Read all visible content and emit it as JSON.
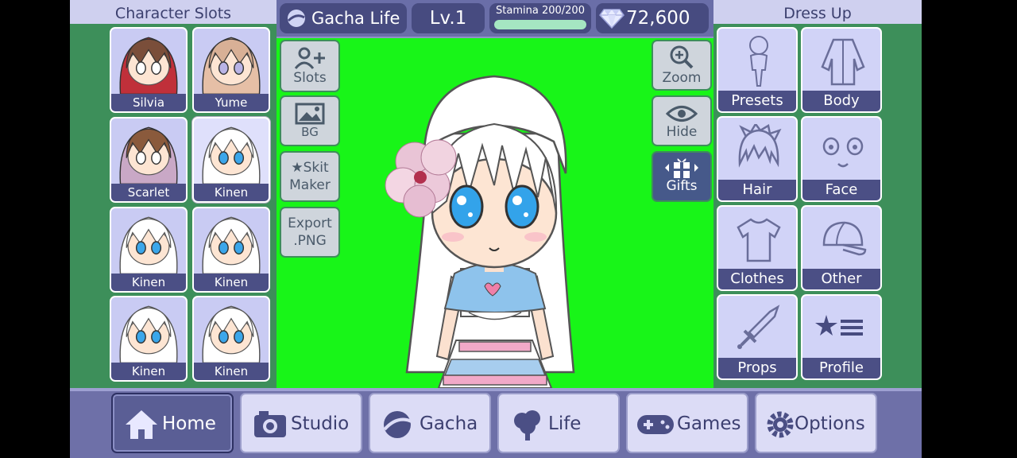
{
  "left_panel": {
    "title": "Character Slots",
    "slots": [
      {
        "name": "Silvia",
        "hair": "#c0303a",
        "hair_top": "#7a4e3a"
      },
      {
        "name": "Yume",
        "hair": "#e6bfa6",
        "hair_top": "#d8b096"
      },
      {
        "name": "Scarlet",
        "hair": "#c9a8c6",
        "hair_top": "#8a5a3c"
      },
      {
        "name": "Kinen",
        "hair": "#ffffff",
        "hair_top": "#ffffff"
      },
      {
        "name": "Kinen",
        "hair": "#ffffff",
        "hair_top": "#ffffff"
      },
      {
        "name": "Kinen",
        "hair": "#ffffff",
        "hair_top": "#ffffff"
      },
      {
        "name": "Kinen",
        "hair": "#ffffff",
        "hair_top": "#ffffff"
      },
      {
        "name": "Kinen",
        "hair": "#ffffff",
        "hair_top": "#ffffff"
      }
    ]
  },
  "topbar": {
    "game_title": "Gacha Life",
    "level": "Lv.1",
    "stamina_label": "Stamina 200/200",
    "stamina_fraction": 1.0,
    "gems": "72,600"
  },
  "stage_tools_left": [
    {
      "label": "Slots",
      "icon": "add-user-icon"
    },
    {
      "label": "BG",
      "icon": "image-icon"
    },
    {
      "label_line1": "★Skit",
      "label_line2": "Maker"
    },
    {
      "label_line1": "Export",
      "label_line2": ".PNG"
    }
  ],
  "stage_tools_right": [
    {
      "label": "Zoom",
      "icon": "zoom-icon"
    },
    {
      "label": "Hide",
      "icon": "eye-icon"
    },
    {
      "label": "Gifts",
      "icon": "gift-icon"
    }
  ],
  "right_panel": {
    "title": "Dress Up",
    "items": [
      "Presets",
      "Body",
      "Hair",
      "Face",
      "Clothes",
      "Other",
      "Props",
      "Profile"
    ]
  },
  "bottom_nav": {
    "items": [
      "Home",
      "Studio",
      "Gacha",
      "Life",
      "Games",
      "Options"
    ],
    "active": "Home"
  },
  "colors": {
    "stage_green": "#18f518",
    "panel_green": "#3d8f5a",
    "accent_navy": "#4b4f85",
    "lavender": "#cfd0ef"
  }
}
